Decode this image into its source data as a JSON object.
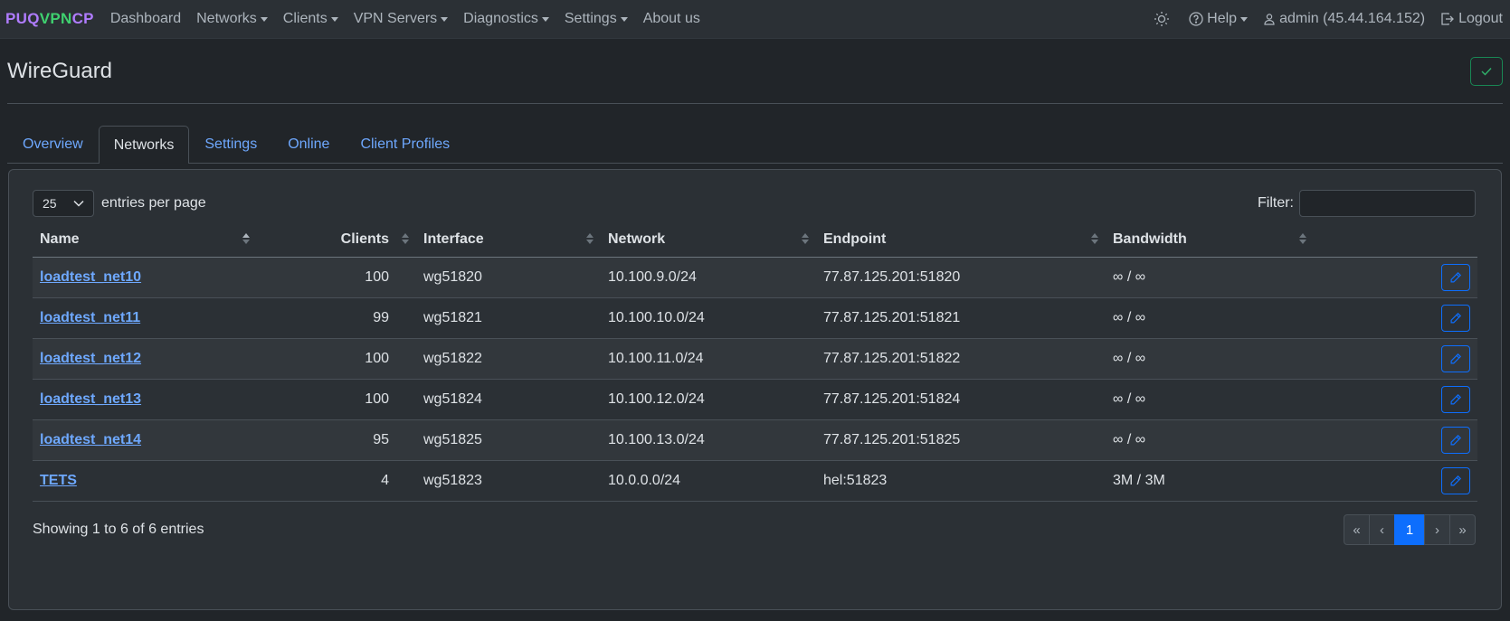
{
  "navbar": {
    "brand": {
      "part1": "PUQ",
      "part2": "VPN",
      "part3": "CP"
    },
    "left_items": [
      {
        "label": "Dashboard",
        "dropdown": false
      },
      {
        "label": "Networks",
        "dropdown": true
      },
      {
        "label": "Clients",
        "dropdown": true
      },
      {
        "label": "VPN Servers",
        "dropdown": true
      },
      {
        "label": "Diagnostics",
        "dropdown": true
      },
      {
        "label": "Settings",
        "dropdown": true
      },
      {
        "label": "About us",
        "dropdown": false
      }
    ],
    "help_label": "Help",
    "user_label": "admin (45.44.164.152)",
    "logout_label": "Logout"
  },
  "page": {
    "title": "WireGuard"
  },
  "tabs": [
    {
      "label": "Overview",
      "active": false
    },
    {
      "label": "Networks",
      "active": true
    },
    {
      "label": "Settings",
      "active": false
    },
    {
      "label": "Online",
      "active": false
    },
    {
      "label": "Client Profiles",
      "active": false
    }
  ],
  "table_controls": {
    "page_size": "25",
    "entries_per_page_label": "entries per page",
    "filter_label": "Filter:",
    "filter_value": ""
  },
  "table": {
    "columns": [
      "Name",
      "Clients",
      "Interface",
      "Network",
      "Endpoint",
      "Bandwidth"
    ],
    "rows": [
      {
        "name": "loadtest_net10",
        "clients": "100",
        "interface": "wg51820",
        "network": "10.100.9.0/24",
        "endpoint": "77.87.125.201:51820",
        "bandwidth": "∞ / ∞"
      },
      {
        "name": "loadtest_net11",
        "clients": "99",
        "interface": "wg51821",
        "network": "10.100.10.0/24",
        "endpoint": "77.87.125.201:51821",
        "bandwidth": "∞ / ∞"
      },
      {
        "name": "loadtest_net12",
        "clients": "100",
        "interface": "wg51822",
        "network": "10.100.11.0/24",
        "endpoint": "77.87.125.201:51822",
        "bandwidth": "∞ / ∞"
      },
      {
        "name": "loadtest_net13",
        "clients": "100",
        "interface": "wg51824",
        "network": "10.100.12.0/24",
        "endpoint": "77.87.125.201:51824",
        "bandwidth": "∞ / ∞"
      },
      {
        "name": "loadtest_net14",
        "clients": "95",
        "interface": "wg51825",
        "network": "10.100.13.0/24",
        "endpoint": "77.87.125.201:51825",
        "bandwidth": "∞ / ∞"
      },
      {
        "name": "TETS",
        "clients": "4",
        "interface": "wg51823",
        "network": "10.0.0.0/24",
        "endpoint": "hel:51823",
        "bandwidth": "3M / 3M"
      }
    ]
  },
  "footer": {
    "info": "Showing 1 to 6 of 6 entries",
    "pagination": [
      "«",
      "‹",
      "1",
      "›",
      "»"
    ],
    "current_page": "1"
  },
  "colors": {
    "accent": "#0d6efd",
    "link": "#6ea8fe",
    "success": "#198754",
    "brand_purple": "#b07cff",
    "brand_green": "#3fd06f"
  }
}
